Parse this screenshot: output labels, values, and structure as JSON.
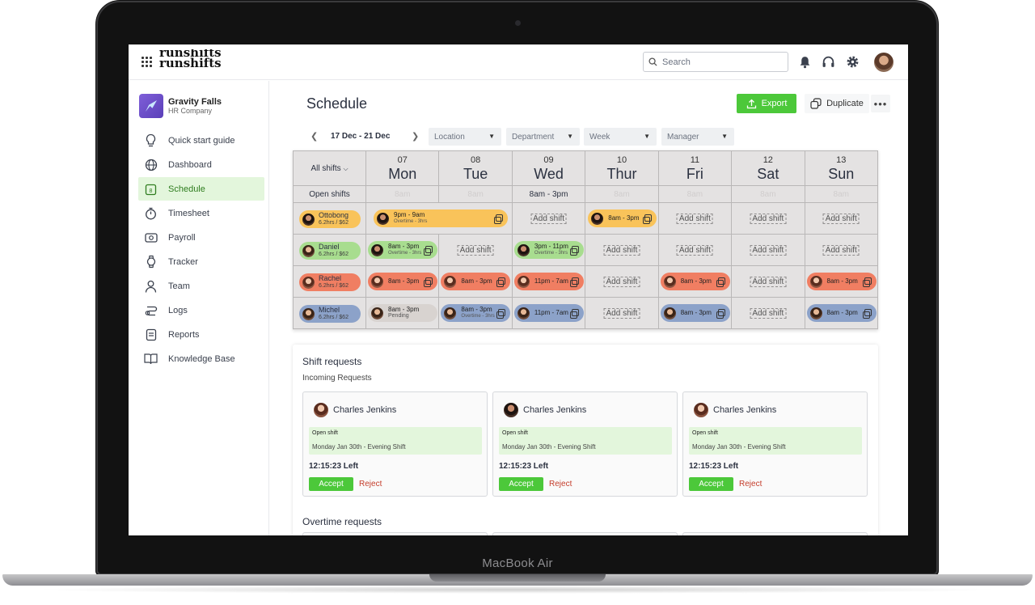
{
  "device": {
    "label": "MacBook Air"
  },
  "app": {
    "logo_line1": "runshifts",
    "logo_line2": "runshifts"
  },
  "topbar": {
    "search_placeholder": "Search",
    "icons": [
      "bell-icon",
      "headset-icon",
      "gear-icon"
    ]
  },
  "org": {
    "name": "Gravity Falls",
    "subtitle": "HR Company"
  },
  "sidebar": {
    "items": [
      {
        "label": "Quick start guide",
        "icon": "lightbulb-icon"
      },
      {
        "label": "Dashboard",
        "icon": "globe-icon"
      },
      {
        "label": "Schedule",
        "icon": "calendar-icon",
        "active": true
      },
      {
        "label": "Timesheet",
        "icon": "stopwatch-icon"
      },
      {
        "label": "Payroll",
        "icon": "money-icon"
      },
      {
        "label": "Tracker",
        "icon": "watch-icon"
      },
      {
        "label": "Team",
        "icon": "person-icon"
      },
      {
        "label": "Logs",
        "icon": "log-icon"
      },
      {
        "label": "Reports",
        "icon": "report-icon"
      },
      {
        "label": "Knowledge Base",
        "icon": "book-icon"
      }
    ]
  },
  "page": {
    "title": "Schedule",
    "export_label": "Export",
    "duplicate_label": "Duplicate",
    "more_label": "•••"
  },
  "filters": {
    "date_range": "17 Dec - 21 Dec",
    "location": "Location",
    "department": "Department",
    "view": "Week",
    "manager": "Manager"
  },
  "schedule": {
    "all_shifts_label": "All shifts",
    "days": [
      {
        "num": "07",
        "name": "Mon"
      },
      {
        "num": "08",
        "name": "Tue"
      },
      {
        "num": "09",
        "name": "Wed"
      },
      {
        "num": "10",
        "name": "Thur"
      },
      {
        "num": "11",
        "name": "Fri"
      },
      {
        "num": "12",
        "name": "Sat"
      },
      {
        "num": "13",
        "name": "Sun"
      }
    ],
    "open_shifts": {
      "label": "Open shifts",
      "values": [
        "8am",
        "8am",
        "8am - 3pm",
        "8am",
        "8am",
        "8am",
        "8am"
      ]
    },
    "add_shift_label": "Add shift",
    "employees": [
      {
        "name": "Ottobong",
        "hours": "6.2hrs / $62",
        "color": "#f9c35a"
      },
      {
        "name": "Daniel",
        "hours": "6.2hrs / $62",
        "color": "#a8dd8f"
      },
      {
        "name": "Rachel",
        "hours": "6.2hrs / $62",
        "color": "#f07e62"
      },
      {
        "name": "Michel",
        "hours": "6.2hrs / $62",
        "color": "#8ca2c9"
      }
    ],
    "shifts": {
      "ottobong_mon": {
        "time": "9pm - 9am",
        "sub": "Overtime - 3hrs"
      },
      "ottobong_thu": {
        "time": "8am - 3pm"
      },
      "daniel_mon": {
        "time": "8am - 3pm",
        "sub": "Overtime - 3hrs"
      },
      "daniel_wed": {
        "time": "3pm - 11pm",
        "sub": "Overtime - 3hrs"
      },
      "rachel_mon": {
        "time": "8am - 3pm"
      },
      "rachel_tue": {
        "time": "8am - 3pm"
      },
      "rachel_wed": {
        "time": "11pm - 7am"
      },
      "rachel_fri": {
        "time": "8am - 3pm"
      },
      "rachel_sun": {
        "time": "8am - 3pm"
      },
      "michel_mon": {
        "time": "8am - 3pm",
        "sub": "Pending"
      },
      "michel_tue": {
        "time": "8am - 3pm",
        "sub": "Overtime - 3hrs"
      },
      "michel_wed": {
        "time": "11pm - 7am"
      },
      "michel_fri": {
        "time": "8am - 3pm"
      },
      "michel_sun": {
        "time": "8am - 3pm"
      }
    }
  },
  "requests": {
    "title": "Shift requests",
    "subtitle": "Incoming Requests",
    "cards": [
      {
        "name": "Charles Jenkins",
        "type": "Open shift",
        "detail": "Monday Jan 30th - Evening Shift",
        "timer": "12:15:23 Left",
        "accept": "Accept",
        "reject": "Reject"
      },
      {
        "name": "Charles Jenkins",
        "type": "Open shift",
        "detail": "Monday Jan 30th - Evening Shift",
        "timer": "12:15:23 Left",
        "accept": "Accept",
        "reject": "Reject"
      },
      {
        "name": "Charles Jenkins",
        "type": "Open shift",
        "detail": "Monday Jan 30th - Evening Shift",
        "timer": "12:15:23 Left",
        "accept": "Accept",
        "reject": "Reject"
      }
    ],
    "overtime_title": "Overtime requests"
  }
}
